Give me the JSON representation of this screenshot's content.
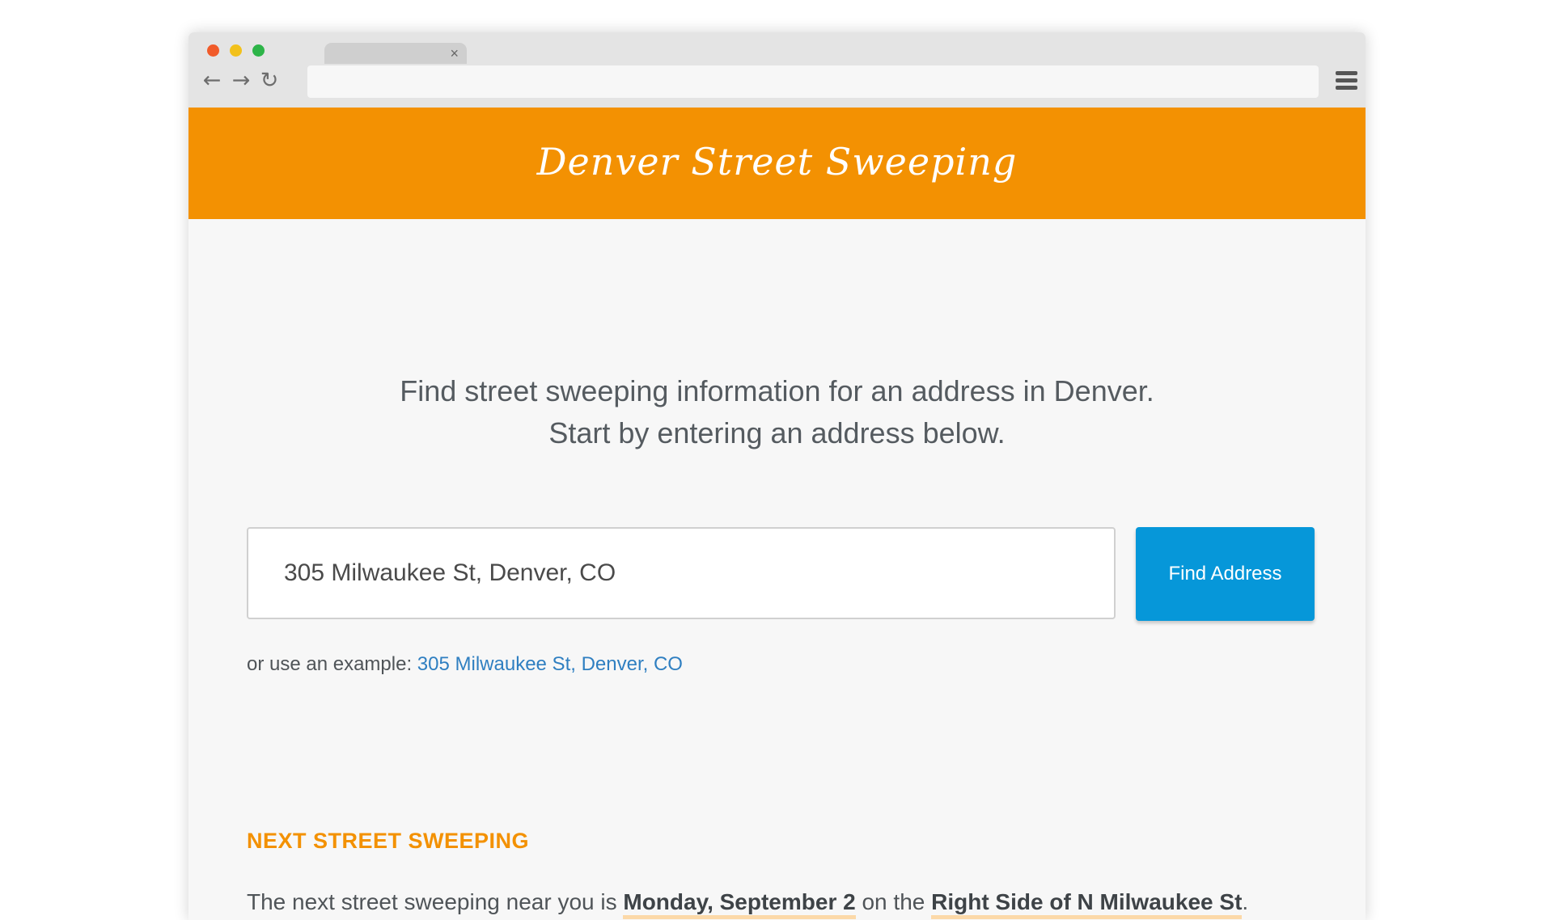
{
  "browser": {
    "tab_close": "×",
    "back_icon": "arrow-left",
    "forward_icon": "arrow-right",
    "reload_icon": "reload",
    "menu_icon": "hamburger-menu"
  },
  "header": {
    "title": "Denver Street Sweeping",
    "background_color": "#f39102"
  },
  "intro": {
    "line1": "Find street sweeping information for an address in Denver.",
    "line2": "Start by entering an address below."
  },
  "search": {
    "value": "305 Milwaukee St, Denver, CO",
    "button_label": "Find Address",
    "button_color": "#0697d9"
  },
  "example": {
    "prefix": "or use an example:",
    "link_text": "305 Milwaukee St, Denver, CO"
  },
  "next_sweeping": {
    "heading": "NEXT STREET SWEEPING",
    "text_before": "The next street sweeping near you is",
    "date": "Monday, September 2",
    "text_middle": "on the",
    "side": "Right Side of N Milwaukee St",
    "text_after": "."
  }
}
